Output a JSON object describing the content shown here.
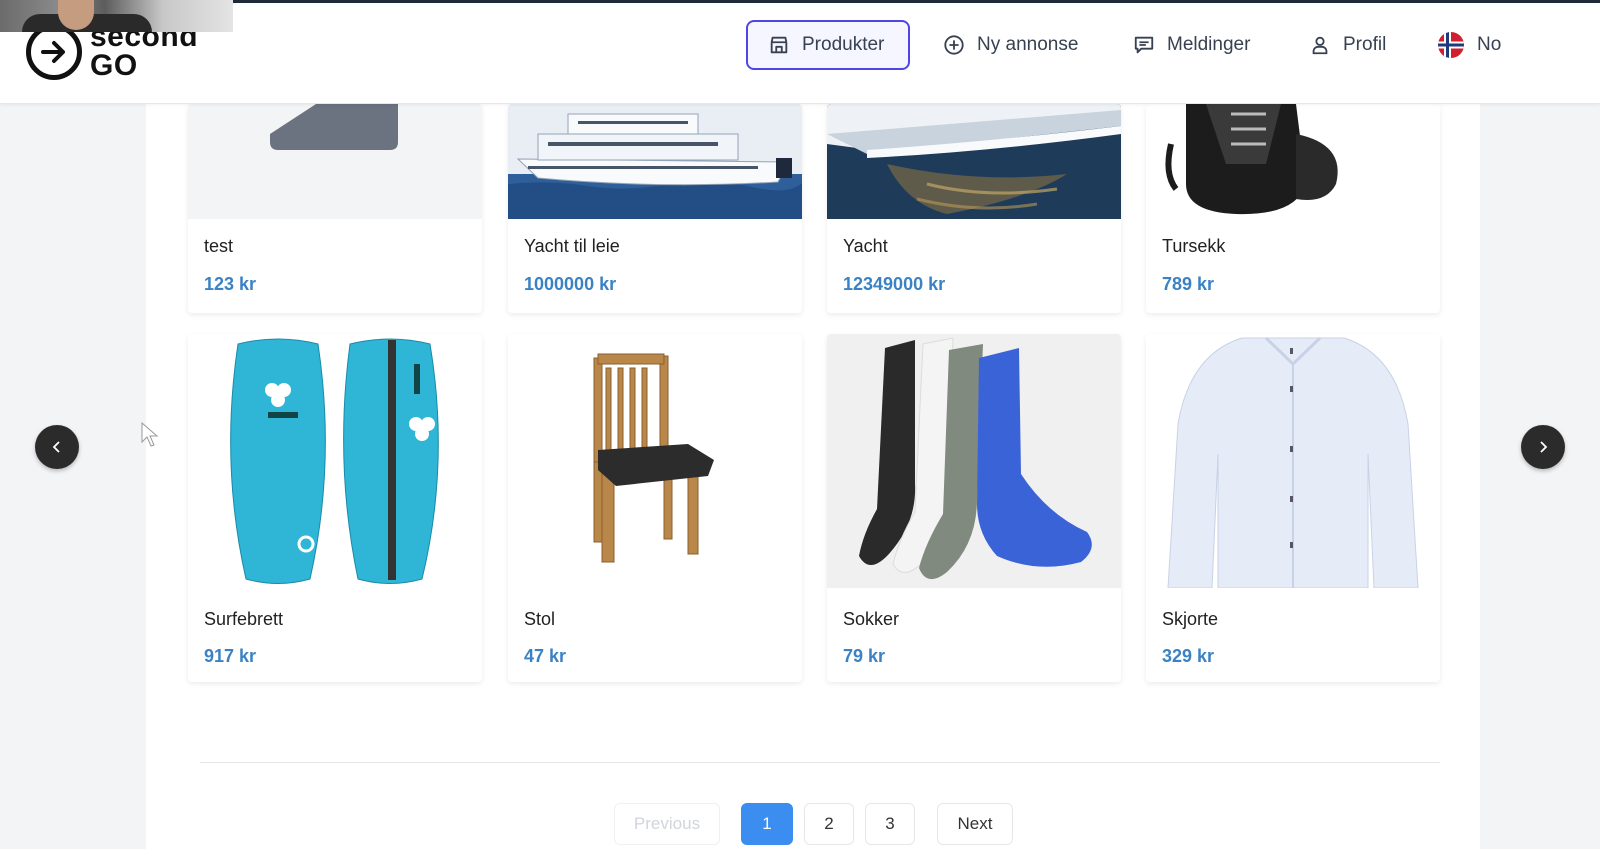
{
  "brand": {
    "line1": "second",
    "line2": "GO"
  },
  "nav": {
    "items": [
      {
        "label": "Produkter",
        "icon": "store-icon",
        "active": true
      },
      {
        "label": "Ny annonse",
        "icon": "plus-circle-icon",
        "active": false
      },
      {
        "label": "Meldinger",
        "icon": "message-icon",
        "active": false
      },
      {
        "label": "Profil",
        "icon": "user-icon",
        "active": false
      },
      {
        "label": "No",
        "icon": "norway-flag-icon",
        "active": false
      }
    ]
  },
  "products": [
    {
      "title": "test",
      "price": "123 kr",
      "image": "placeholder-image"
    },
    {
      "title": "Yacht til leie",
      "price": "1000000 kr",
      "image": "yacht-photo"
    },
    {
      "title": "Yacht",
      "price": "12349000 kr",
      "image": "yacht-photo"
    },
    {
      "title": "Tursekk",
      "price": "789 kr",
      "image": "backpack-photo"
    },
    {
      "title": "Surfebrett",
      "price": "917 kr",
      "image": "surfboard-photo"
    },
    {
      "title": "Stol",
      "price": "47 kr",
      "image": "chair-photo"
    },
    {
      "title": "Sokker",
      "price": "79 kr",
      "image": "socks-photo"
    },
    {
      "title": "Skjorte",
      "price": "329 kr",
      "image": "shirt-photo"
    }
  ],
  "pagination": {
    "previous": "Previous",
    "pages": [
      "1",
      "2",
      "3"
    ],
    "current": "1",
    "next": "Next"
  },
  "colors": {
    "accent": "#4f46e5",
    "price": "#3b82c4",
    "page_active": "#3b8df0"
  }
}
